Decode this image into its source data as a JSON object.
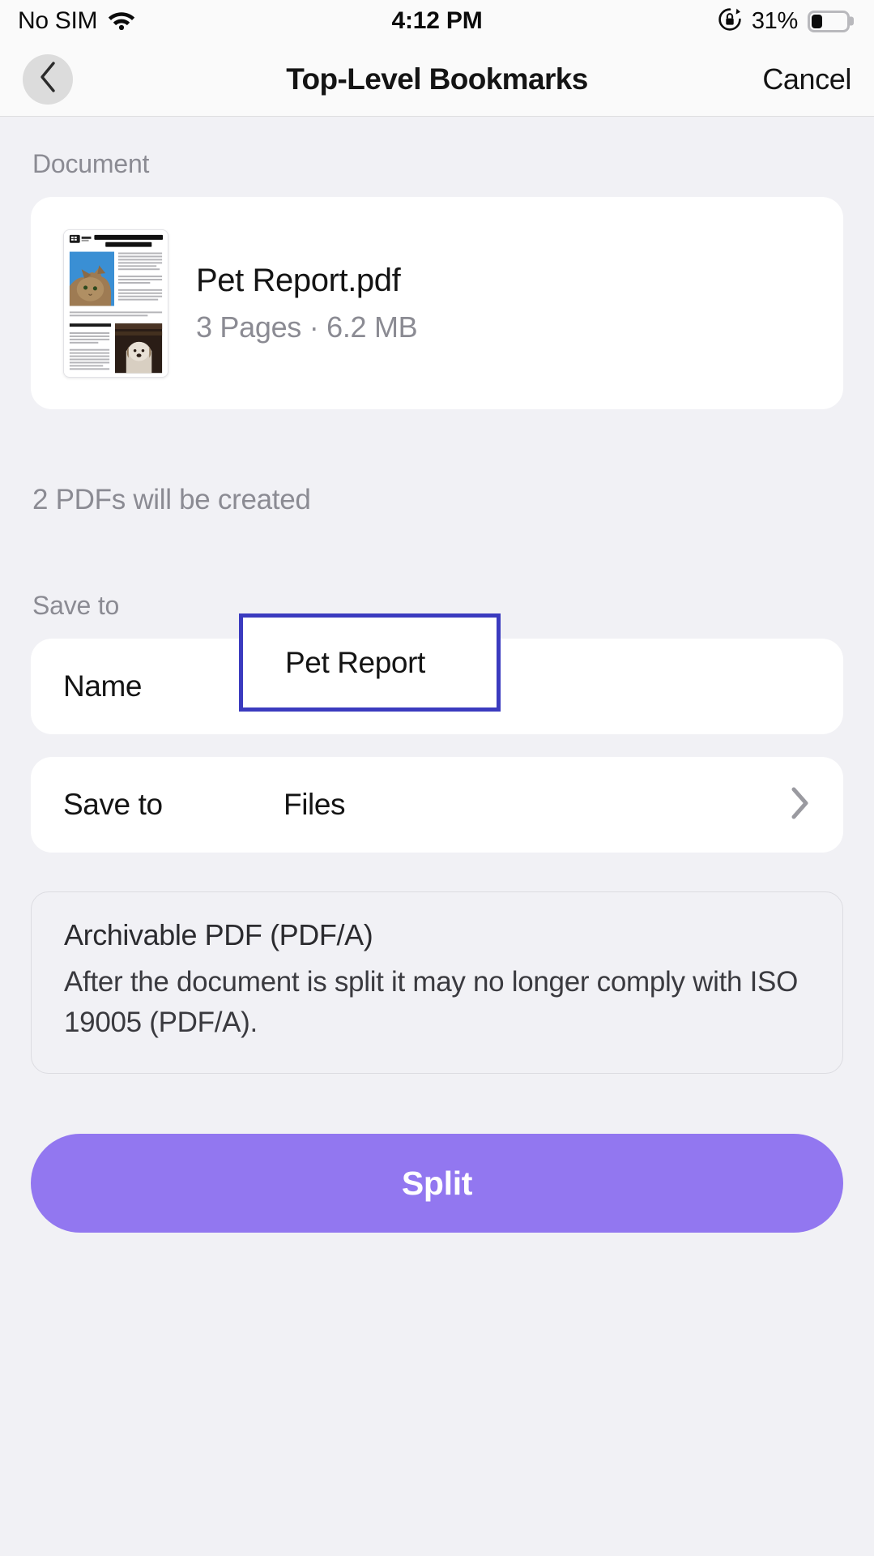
{
  "status_bar": {
    "carrier": "No SIM",
    "wifi_icon": "wifi-icon",
    "time": "4:12 PM",
    "rotation_lock_icon": "rotation-lock-icon",
    "battery_percent": "31%",
    "battery_level": 31
  },
  "nav": {
    "back_icon": "chevron-left-icon",
    "title": "Top-Level Bookmarks",
    "cancel_label": "Cancel"
  },
  "document_section": {
    "label": "Document",
    "thumbnail_icon": "pdf-page-thumbnail",
    "file_name": "Pet Report.pdf",
    "file_meta": "3 Pages · 6.2 MB",
    "pages": "3 Pages",
    "size": "6.2 MB"
  },
  "info": {
    "pdf_count_text": "2 PDFs will be created"
  },
  "save_to_section": {
    "label": "Save to",
    "rows": [
      {
        "label": "Name",
        "value": "Pet Report",
        "focused": true
      },
      {
        "label": "Save to",
        "value": "Files",
        "chevron_icon": "chevron-right-icon"
      }
    ]
  },
  "notice": {
    "title": "Archivable PDF (PDF/A)",
    "body": "After the document is split it may no longer comply with ISO 19005 (PDF/A)."
  },
  "action": {
    "split_label": "Split"
  },
  "colors": {
    "accent": "#9277f0",
    "focus_outline": "#3b3bbf",
    "background": "#f1f1f5",
    "card": "#ffffff",
    "secondary_text": "#8b8b93",
    "primary_text": "#141414"
  }
}
